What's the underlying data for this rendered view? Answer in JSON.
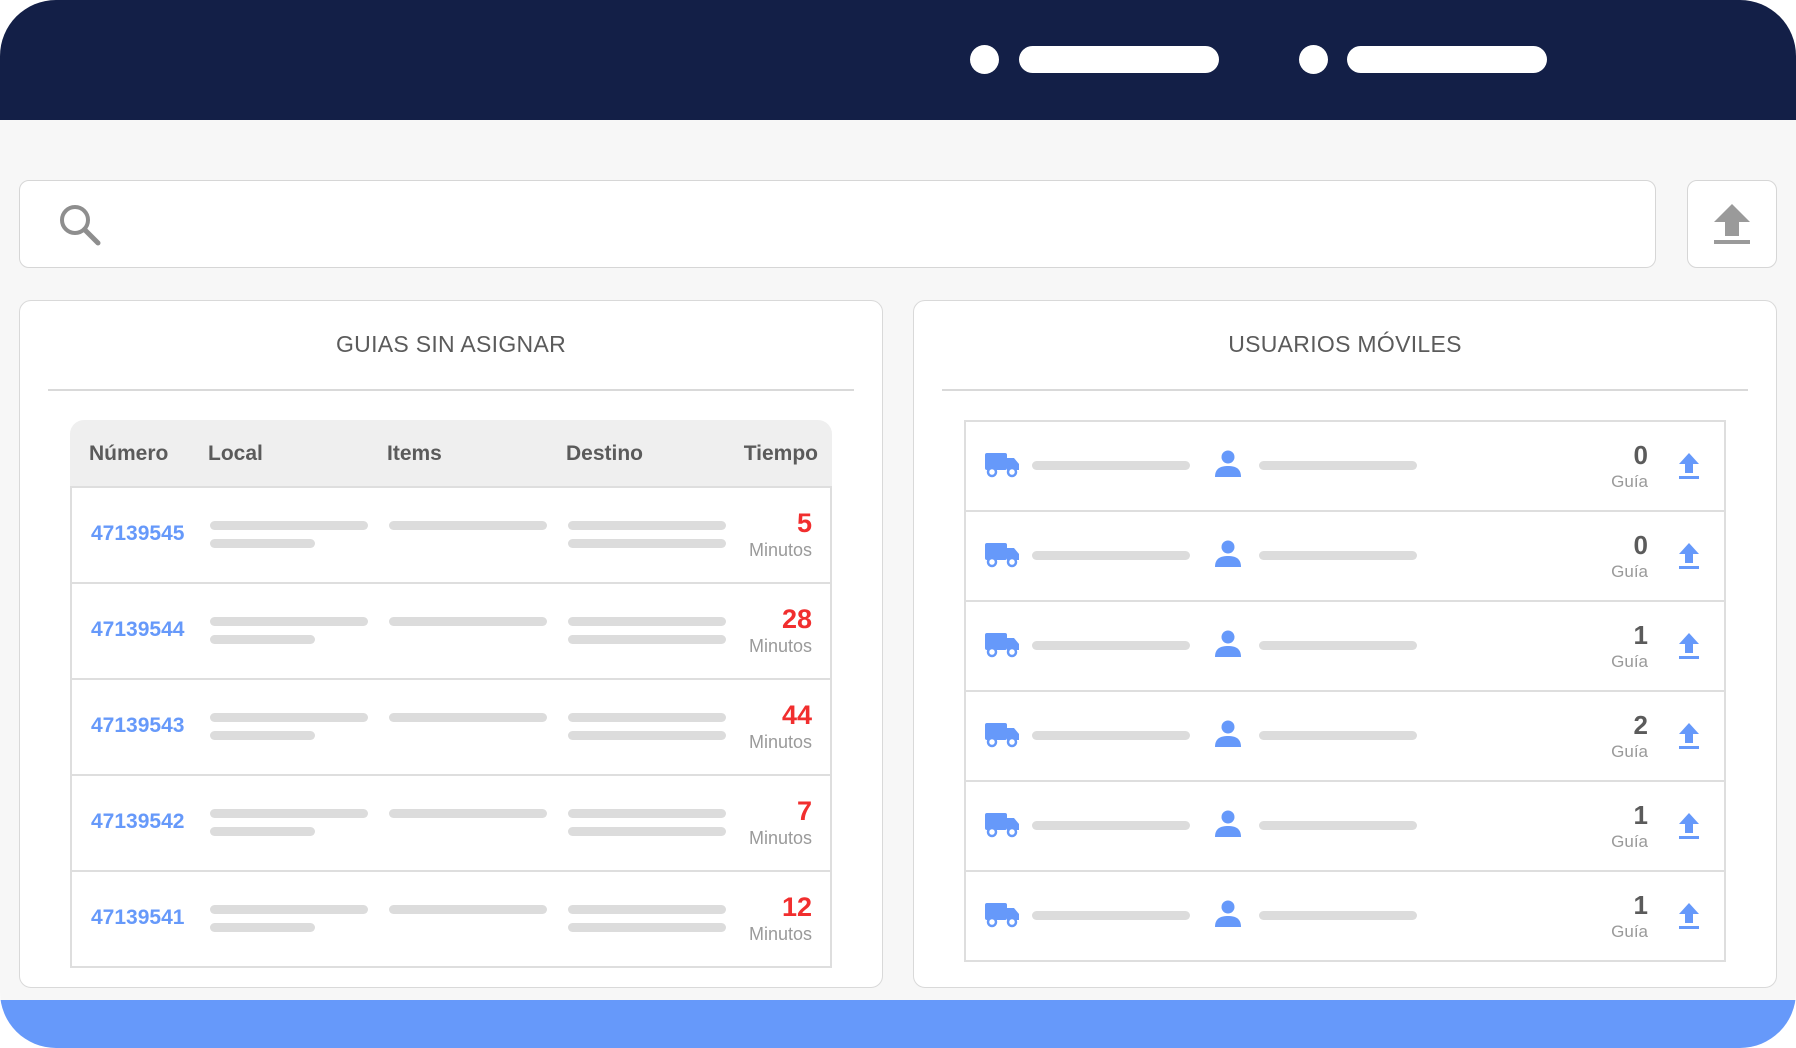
{
  "colors": {
    "topbar": "#131f47",
    "bottombar": "#6699fa",
    "accent": "#6699fa",
    "alert": "#f12e2e"
  },
  "search": {
    "placeholder": ""
  },
  "left_panel": {
    "title": "GUIAS SIN ASIGNAR",
    "columns": [
      "Número",
      "Local",
      "Items",
      "Destino",
      "Tiempo"
    ],
    "rows": [
      {
        "numero": "47139545",
        "tiempo": "5",
        "unit": "Minutos"
      },
      {
        "numero": "47139544",
        "tiempo": "28",
        "unit": "Minutos"
      },
      {
        "numero": "47139543",
        "tiempo": "44",
        "unit": "Minutos"
      },
      {
        "numero": "47139542",
        "tiempo": "7",
        "unit": "Minutos"
      },
      {
        "numero": "47139541",
        "tiempo": "12",
        "unit": "Minutos"
      }
    ]
  },
  "right_panel": {
    "title": "USUARIOS MÓVILES",
    "rows": [
      {
        "count": "0",
        "unit": "Guía"
      },
      {
        "count": "0",
        "unit": "Guía"
      },
      {
        "count": "1",
        "unit": "Guía"
      },
      {
        "count": "2",
        "unit": "Guía"
      },
      {
        "count": "1",
        "unit": "Guía"
      },
      {
        "count": "1",
        "unit": "Guía"
      }
    ]
  },
  "icons": {
    "search": "search-icon",
    "upload": "upload-icon",
    "truck": "truck-icon",
    "user": "user-icon"
  }
}
